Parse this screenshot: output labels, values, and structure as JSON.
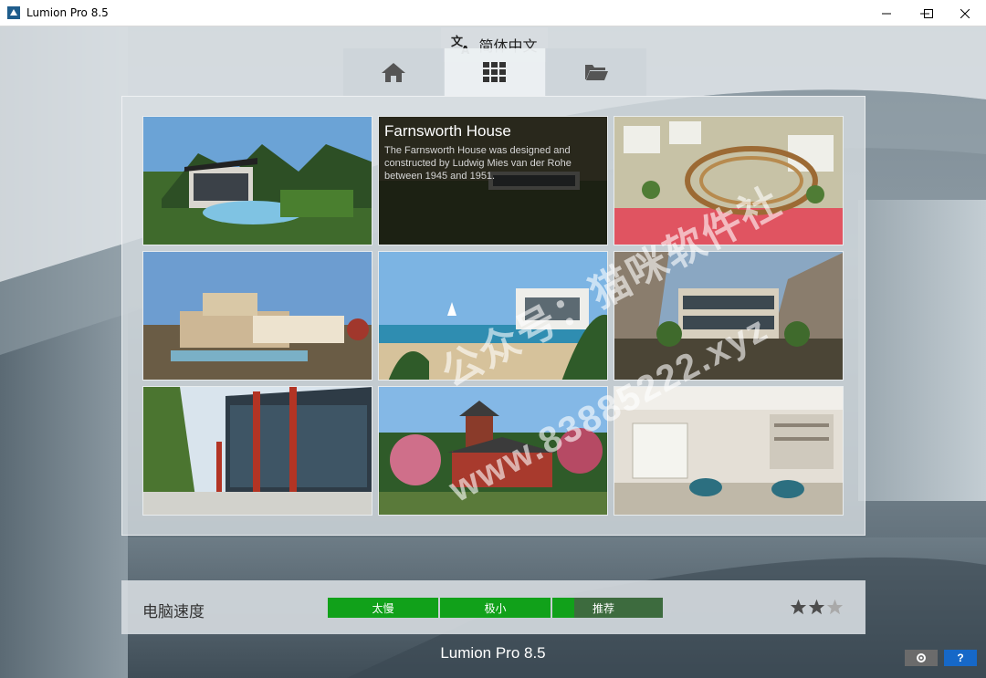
{
  "window": {
    "title": "Lumion Pro 8.5"
  },
  "language": {
    "label": "简体中文"
  },
  "tabs": [
    {
      "icon": "home-icon"
    },
    {
      "icon": "grid-icon"
    },
    {
      "icon": "folder-icon"
    }
  ],
  "projects": [
    {
      "name": ""
    },
    {
      "name": "Farnsworth House",
      "description": "The Farnsworth House was designed and constructed by Ludwig Mies van der Rohe between 1945 and 1951."
    },
    {
      "name": ""
    },
    {
      "name": ""
    },
    {
      "name": ""
    },
    {
      "name": ""
    },
    {
      "name": ""
    },
    {
      "name": ""
    },
    {
      "name": ""
    }
  ],
  "watermark": {
    "line1": "公众号：猫咪软件社",
    "line2": "www.83885222.xyz"
  },
  "performance": {
    "label": "电脑速度",
    "segments": [
      "太慢",
      "极小",
      "推荐"
    ],
    "stars_filled": 2,
    "stars_total": 3
  },
  "footer": {
    "title": "Lumion Pro 8.5"
  },
  "colors": {
    "accent_green": "#11a11a",
    "recommend": "#3d6b3e"
  }
}
